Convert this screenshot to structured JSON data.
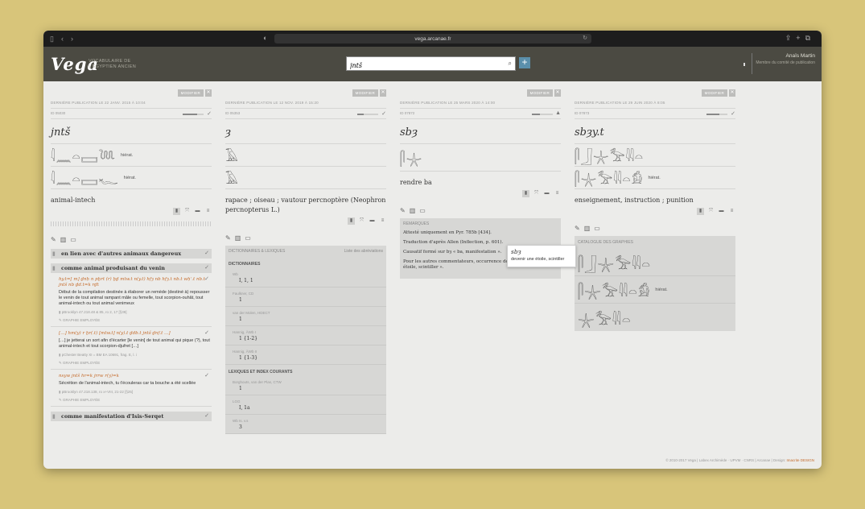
{
  "browser": {
    "url": "vega.arcanae.fr"
  },
  "header": {
    "logo": "Vega",
    "tagline": "VOCABULAIRE DE L'ÉGYPTIEN ANCIEN",
    "search_value": "jntš",
    "user_name": "Anaïs Martin",
    "user_role": "Membre du comité de publication"
  },
  "common": {
    "modify": "MODIFIER",
    "graphie": "GRAPHIE EMPLOYÉE"
  },
  "col1": {
    "meta": "DERNIÈRE PUBLICATION LE 22 JANV. 2015 À 10:04",
    "id": "ID 05030",
    "progress": 0.7,
    "lemma": "jntš",
    "hiero1": "𓇋𓈖𓏏𓈙𓆙",
    "hiero1_label": "hiérat.",
    "hiero2": "𓇋𓈖𓏏𓈙𓆑",
    "hiero2_label": "hiérat.",
    "translation": "animal-intech",
    "sections": [
      "en lien avec d'autres animaux dangereux",
      "comme animal produisant du venin",
      "comme manifestation d'Isis-Serqet"
    ],
    "examples": [
      {
        "tr": "hy.t=[ m] ḏnḥ n pḫrt (r) ḫḏ mtw.t n(y.t) hfȝ nb hfȝ.t nb.t wḥʿ.t nb.t jntš nb ḏd.t=k rḏt",
        "fr": "Début de la compilation destinée à élaborer un remède (destiné à) repousser le venin de tout animal rampant mâle ou femelle, tout scorpion-ouhât, tout animal-intech ou tout animal venimeux",
        "src": "pBrooklyn 47.218.48 & 85, ro 2, 17 [§39]"
      },
      {
        "tr": "[…] hm(y) r ḫr(.t) [mtw.t] n(y).t ḏdb.t jntš ḏnf.t …]",
        "fr": "[…] je jetterai un sort afin d'écarter [le venin] de tout animal qui pique (?), tout animal-intech et tout scorpion-djufret […]",
        "src": "pChester Beatty XI = BM EA 10691, frag. E, l. i"
      },
      {
        "tr": "nsyw jntš hr=k jrrw r(ȝ)=k",
        "fr": "Sécrétion de l'animal-intech, tu t'écouleras car ta bouche a été scellée",
        "src": "pBrooklyn 47.218.138, ro x+VIII, 21-22 [§25]"
      }
    ]
  },
  "col2": {
    "meta": "DERNIÈRE PUBLICATION LE 12 NOV. 2019 À 15:20",
    "id": "ID 05353",
    "progress": 0.3,
    "lemma": "ȝ",
    "hiero1": "𓄿",
    "hiero2": "𓄿",
    "translation": "rapace ; oiseau ; vautour percnoptère (Neophron percnopterus L.)",
    "panel_title": "DICTIONNAIRES & LEXIQUES",
    "panel_link": "Liste des abréviations",
    "dict_heading": "DICTIONNAIRES",
    "lex_heading": "LEXIQUES ET INDEX COURANTS",
    "dicts": [
      {
        "name": "Wb",
        "val": "I, 1, 1"
      },
      {
        "name": "Faulkner, CD",
        "val": "1"
      },
      {
        "name": "van der Molen, HDECT",
        "val": "1"
      },
      {
        "name": "Hannig, ÄWb I",
        "val": "1 {1-2}"
      },
      {
        "name": "Hannig, ÄWb II",
        "val": "1 {1-3}"
      }
    ],
    "lex": [
      {
        "name": "Borghouts, van der Plas, CTW",
        "val": "1"
      },
      {
        "name": "LGG",
        "val": "I, 1a"
      },
      {
        "name": "Wb Is. v.s",
        "val": "3"
      }
    ]
  },
  "col3": {
    "meta": "DERNIÈRE PUBLICATION LE 25 MARS 2020 À 14:00",
    "id": "ID 07872",
    "progress": 0.4,
    "lemma": "sbȝ",
    "hiero1": "𓋴𓇼",
    "translation": "rendre ba",
    "rem_title": "REMARQUES",
    "remarks": [
      "Attesté uniquement en Pyr. 785b [434].",
      "Traduction d'après Allen (Inflection, p. 601).",
      "Causatif formé sur bȝ « ba, manifestation ».",
      "Pour les autres commentateurs, occurrence de sbȝ « devenir une étoile, scintiller »."
    ],
    "tooltip_title": "sbȝ",
    "tooltip_text": "devenir une étoile, scintiller"
  },
  "col4": {
    "meta": "DERNIÈRE PUBLICATION LE 29 JUIN 2020 À 8:05",
    "id": "ID 07873",
    "progress": 0.6,
    "lemma": "sbȝy.t",
    "hiero1": "𓋴𓃀𓇼𓅡𓇌𓏏",
    "hiero2": "𓋴𓇼𓅡𓇌𓏏𓀁",
    "hiero2_label": "hiérat.",
    "translation": "enseignement, instruction ; punition",
    "cat_title": "CATALOGUE DES GRAPHIES",
    "cat": [
      {
        "g": "𓋴𓃀𓇼𓅡𓇌𓏏",
        "label": ""
      },
      {
        "g": "𓋴𓇼𓅡𓇌𓏏𓀁",
        "label": "hiérat."
      },
      {
        "g": "𓇼𓅡𓇌𓏏",
        "label": ""
      }
    ]
  },
  "footer": {
    "copy": "© 2010-2017 Vega | Labex Archimède · UPVM · CNRS | Arcanae | Design:",
    "design": "Imacrite DESIGN"
  }
}
